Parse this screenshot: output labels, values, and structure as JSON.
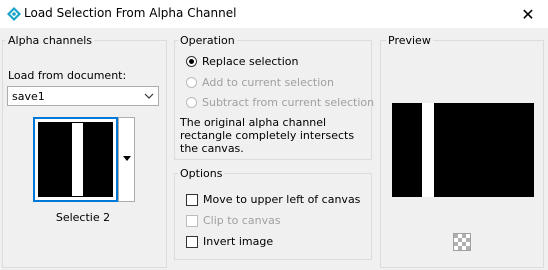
{
  "window": {
    "title": "Load Selection From Alpha Channel",
    "close_glyph": "✕"
  },
  "alpha": {
    "group_label": "Alpha channels",
    "load_label": "Load from document:",
    "document_value": "save1",
    "thumb_name": "Selectie 2"
  },
  "operation": {
    "group_label": "Operation",
    "options": [
      {
        "label": "Replace selection",
        "selected": true,
        "enabled": true
      },
      {
        "label": "Add to current selection",
        "selected": false,
        "enabled": false
      },
      {
        "label": "Subtract from current selection",
        "selected": false,
        "enabled": false
      }
    ],
    "message": "The original alpha channel rectangle completely intersects the canvas."
  },
  "options": {
    "group_label": "Options",
    "items": [
      {
        "label": "Move to upper left of canvas",
        "checked": false,
        "enabled": true
      },
      {
        "label": "Clip to canvas",
        "checked": false,
        "enabled": false
      },
      {
        "label": "Invert image",
        "checked": false,
        "enabled": true
      }
    ]
  },
  "preview": {
    "group_label": "Preview"
  },
  "icons": {
    "app": "paintshop-app-icon",
    "close": "close-icon",
    "dropdown": "chevron-down-icon",
    "checker": "transparency-checker-icon"
  },
  "colors": {
    "selection_border": "#0078d7",
    "app_icon": "#1aa3c9"
  }
}
